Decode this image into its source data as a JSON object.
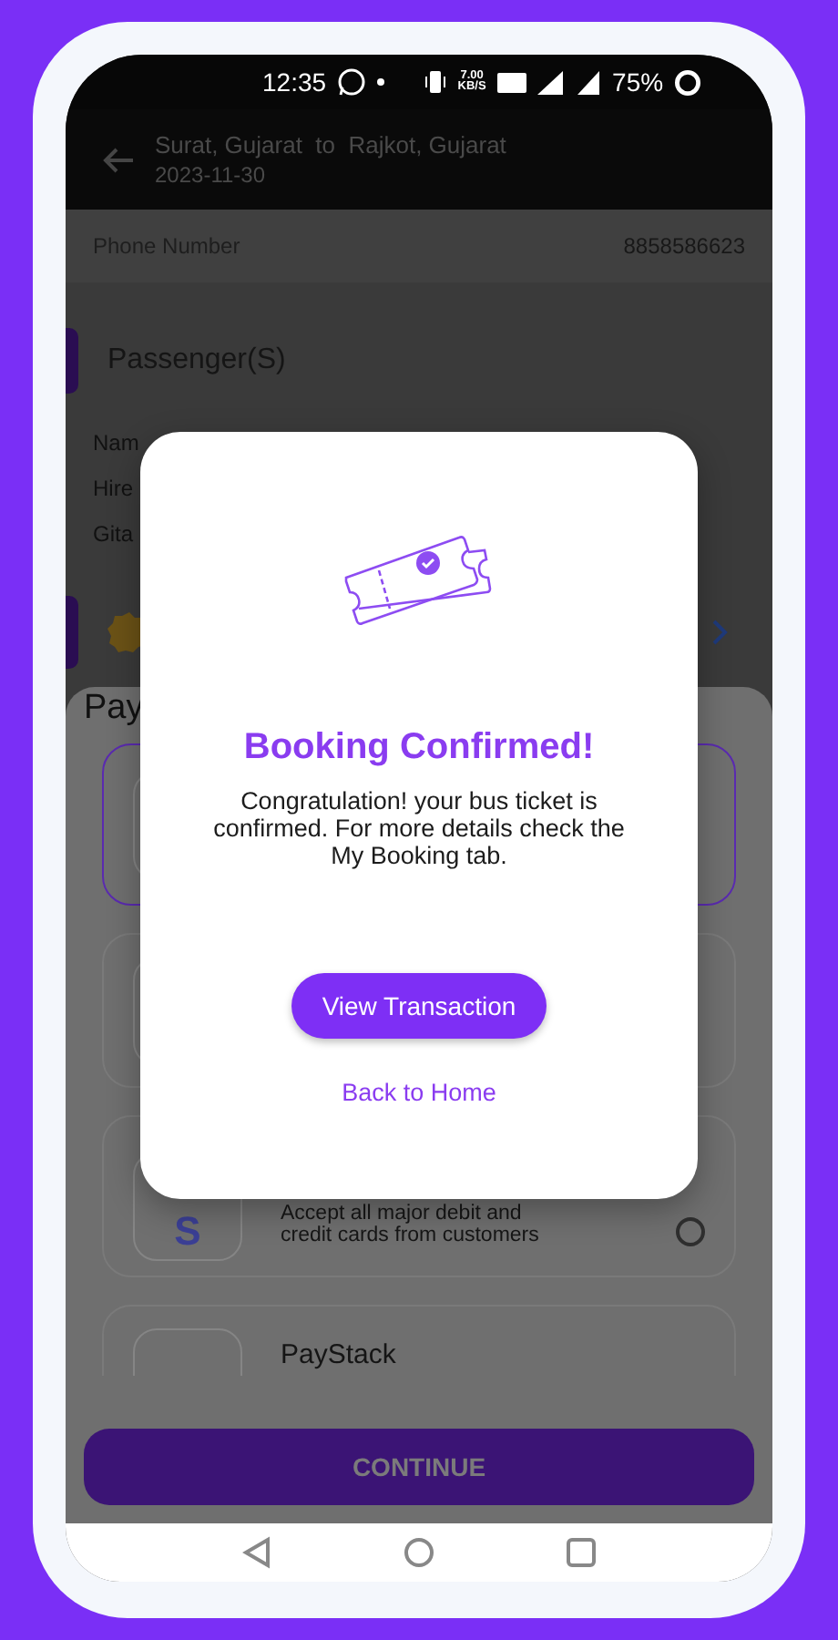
{
  "status_bar": {
    "time": "12:35",
    "net_speed": "7.00 KB/S",
    "battery": "75%"
  },
  "app_bar": {
    "route": "Surat, Gujarat  to  Rajkot, Gujarat",
    "date": "2023-11-30"
  },
  "phone": {
    "label": "Phone Number",
    "value": "8858586623"
  },
  "passengers": {
    "title": "Passenger(S)",
    "rows": [
      "Nam",
      "Hire",
      "Gita"
    ]
  },
  "payment": {
    "title": "Pay",
    "options": [
      {
        "selected": true
      },
      {
        "selected": false
      },
      {
        "logo": "S",
        "description": "Accept all major debit and credit cards from customers",
        "selected": false
      },
      {
        "name": "PayStack",
        "selected": false
      }
    ]
  },
  "continue_button": "CONTINUE",
  "dialog": {
    "title": "Booking Confirmed!",
    "message": "Congratulation! your bus ticket is confirmed. For more details check the My Booking tab.",
    "primary_button": "View Transaction",
    "link": "Back to Home"
  }
}
